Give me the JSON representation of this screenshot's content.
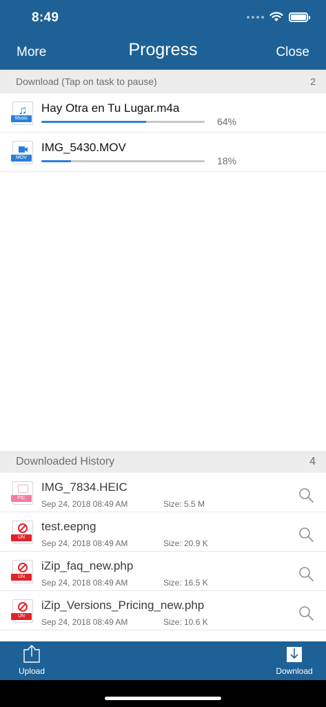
{
  "status_bar": {
    "time": "8:49"
  },
  "nav": {
    "left": "More",
    "title": "Progress",
    "right": "Close"
  },
  "download_section": {
    "header": "Download (Tap on task to pause)",
    "count": "2",
    "tasks": [
      {
        "name": "Hay Otra en Tu Lugar.m4a",
        "icon": "music-file-icon",
        "tag": "Music",
        "progress_percent": 64,
        "progress_label": "64%"
      },
      {
        "name": "IMG_5430.MOV",
        "icon": "video-file-icon",
        "tag": "MOV",
        "progress_percent": 18,
        "progress_label": "18%"
      }
    ]
  },
  "history_section": {
    "header": "Downloaded History",
    "count": "4",
    "items": [
      {
        "name": "IMG_7834.HEIC",
        "icon": "picture-file-icon",
        "tag": "PIC",
        "date": "Sep 24, 2018 08:49 AM",
        "size": "Size: 5.5 M"
      },
      {
        "name": "test.eepng",
        "icon": "unknown-file-icon",
        "tag": "UN",
        "date": "Sep 24, 2018 08:49 AM",
        "size": "Size: 20.9 K"
      },
      {
        "name": "iZip_faq_new.php",
        "icon": "unknown-file-icon",
        "tag": "UN",
        "date": "Sep 24, 2018 08:49 AM",
        "size": "Size: 16.5 K"
      },
      {
        "name": "iZip_Versions_Pricing_new.php",
        "icon": "unknown-file-icon",
        "tag": "UN",
        "date": "Sep 24, 2018 08:49 AM",
        "size": "Size: 10.6 K"
      }
    ]
  },
  "toolbar": {
    "upload_label": "Upload",
    "download_label": "Download"
  },
  "colors": {
    "bar": "#1e6196",
    "accent": "#2d7fd6",
    "section_bg": "#ececec",
    "unknown_tag": "#e0242a",
    "pic_tag": "#f07da0"
  }
}
